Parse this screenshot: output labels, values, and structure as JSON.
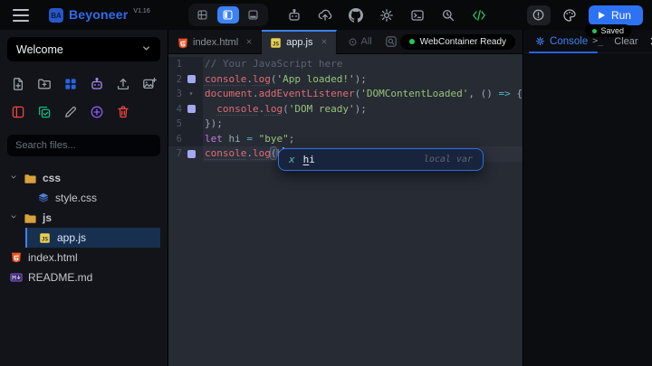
{
  "topbar": {
    "brand": {
      "name": "Beyoneer",
      "version": "V1.16",
      "logo_text": "BA"
    },
    "view_toggles": [
      {
        "icon": "layout-grid",
        "active": false
      },
      {
        "icon": "layout-split",
        "active": true
      },
      {
        "icon": "layout-bottom",
        "active": false
      }
    ],
    "icons": [
      "bot",
      "upload-cloud",
      "github",
      "settings",
      "terminal",
      "debug",
      "code"
    ],
    "alert_icon": "alert",
    "palette_icon": "palette",
    "run_label": "Run",
    "saved_label": "Saved"
  },
  "sidebar": {
    "project_value": "Welcome",
    "tools_row1": [
      {
        "icon": "file-plus",
        "color": "#9aa0a8"
      },
      {
        "icon": "folder-plus",
        "color": "#9aa0a8"
      },
      {
        "icon": "grid",
        "color": "#2563eb"
      },
      {
        "icon": "bot",
        "color": "#a78bfa"
      },
      {
        "icon": "upload",
        "color": "#9aa0a8"
      },
      {
        "icon": "image-plus",
        "color": "#9aa0a8"
      }
    ],
    "tools_row2": [
      {
        "icon": "panel",
        "color": "#ef4444"
      },
      {
        "icon": "copy-check",
        "color": "#10b981"
      },
      {
        "icon": "pencil",
        "color": "#9aa0a8"
      },
      {
        "icon": "plus-circle",
        "color": "#8b5cf6"
      },
      {
        "icon": "trash",
        "color": "#ef4444"
      }
    ],
    "search_placeholder": "Search files...",
    "tree": [
      {
        "type": "folder",
        "label": "css",
        "expanded": true,
        "children": [
          {
            "type": "file",
            "label": "style.css",
            "icon": "css",
            "selected": false
          }
        ]
      },
      {
        "type": "folder",
        "label": "js",
        "expanded": true,
        "children": [
          {
            "type": "file",
            "label": "app.js",
            "icon": "js",
            "selected": true
          }
        ]
      },
      {
        "type": "file",
        "label": "index.html",
        "icon": "html",
        "selected": false
      },
      {
        "type": "file",
        "label": "README.md",
        "icon": "md",
        "selected": false
      }
    ]
  },
  "editor": {
    "tabs": [
      {
        "label": "index.html",
        "icon": "html",
        "active": false
      },
      {
        "label": "app.js",
        "icon": "js",
        "active": true
      }
    ],
    "close_all_label": "All",
    "status_pill": "WebContainer Ready",
    "lines": [
      {
        "n": 1,
        "m": null,
        "active": false,
        "tokens": [
          {
            "t": "// Your JavaScript here",
            "c": "comment"
          }
        ]
      },
      {
        "n": 2,
        "m": "log",
        "active": false,
        "tokens": [
          {
            "t": "console",
            "c": "coral u"
          },
          {
            "t": ".",
            "c": "plain"
          },
          {
            "t": "log",
            "c": "coral u"
          },
          {
            "t": "(",
            "c": "plain"
          },
          {
            "t": "'App loaded!'",
            "c": "str"
          },
          {
            "t": ");",
            "c": "plain"
          }
        ]
      },
      {
        "n": 3,
        "m": "fold",
        "active": false,
        "tokens": [
          {
            "t": "document",
            "c": "coral"
          },
          {
            "t": ".",
            "c": "plain"
          },
          {
            "t": "addEventListener",
            "c": "coral"
          },
          {
            "t": "(",
            "c": "plain"
          },
          {
            "t": "'DOMContentLoaded'",
            "c": "str"
          },
          {
            "t": ", () ",
            "c": "plain"
          },
          {
            "t": "=>",
            "c": "op"
          },
          {
            "t": " {",
            "c": "plain"
          }
        ]
      },
      {
        "n": 4,
        "m": "log",
        "active": false,
        "tokens": [
          {
            "t": "  ",
            "c": "plain"
          },
          {
            "t": "console",
            "c": "coral u"
          },
          {
            "t": ".",
            "c": "plain"
          },
          {
            "t": "log",
            "c": "coral u"
          },
          {
            "t": "(",
            "c": "plain"
          },
          {
            "t": "'DOM ready'",
            "c": "str"
          },
          {
            "t": ");",
            "c": "plain"
          }
        ]
      },
      {
        "n": 5,
        "m": null,
        "active": false,
        "tokens": [
          {
            "t": "});",
            "c": "plain"
          }
        ]
      },
      {
        "n": 6,
        "m": null,
        "active": false,
        "tokens": [
          {
            "t": "let",
            "c": "kw"
          },
          {
            "t": " hi ",
            "c": "plain"
          },
          {
            "t": "=",
            "c": "op"
          },
          {
            "t": " ",
            "c": "plain"
          },
          {
            "t": "\"bye\"",
            "c": "str"
          },
          {
            "t": ";",
            "c": "plain"
          }
        ]
      },
      {
        "n": 7,
        "m": "log",
        "active": true,
        "tokens": [
          {
            "t": "console",
            "c": "coral u"
          },
          {
            "t": ".",
            "c": "plain"
          },
          {
            "t": "log",
            "c": "coral u"
          },
          {
            "t": "(",
            "c": "plain hl"
          },
          {
            "t": "h",
            "c": "plain"
          },
          {
            "t": "",
            "c": "caret"
          },
          {
            "t": ");",
            "c": "plain"
          }
        ]
      }
    ],
    "popup": {
      "kind": "x",
      "label": "hi",
      "match_len": 1,
      "detail": "local var"
    }
  },
  "console_panel": {
    "title": "Console",
    "prompt_label": ">_",
    "clear_label": "Clear"
  },
  "colors": {
    "accent": "#3b82f6",
    "run_button": "#2e72f4",
    "ready_dot": "#22c55e",
    "selection_bg": "#17304f",
    "syntax": {
      "comment": "#5c6370",
      "name": "#e06c75",
      "string": "#98c379",
      "keyword": "#c678dd",
      "operator": "#56b6c2",
      "plain": "#9da5b4"
    }
  }
}
